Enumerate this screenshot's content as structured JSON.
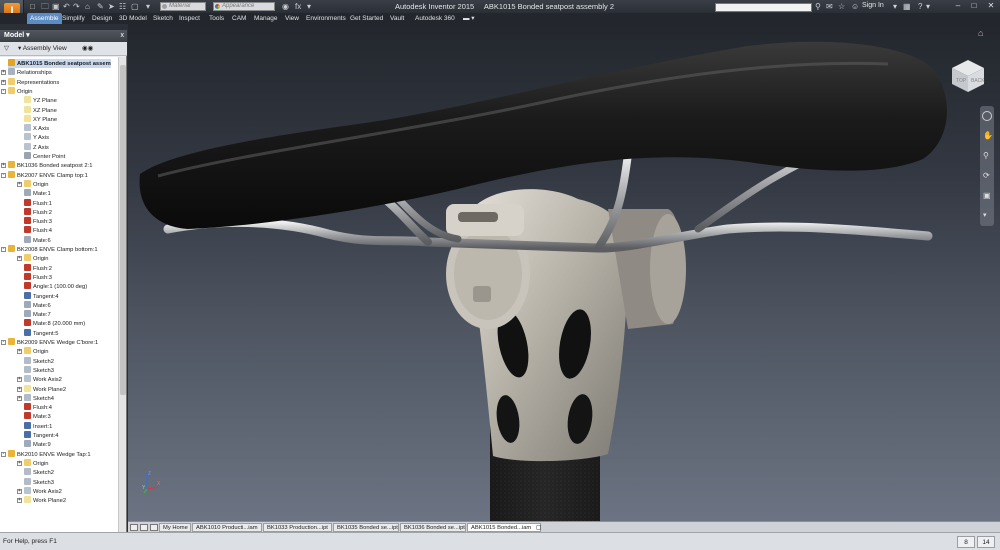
{
  "window": {
    "app_name": "Autodesk Inventor 2015",
    "document_title": "ABK1015 Bonded seatpost assembly 2"
  },
  "quick_access": {
    "material_placeholder": "Material",
    "appearance_placeholder": "Appearance"
  },
  "signin_label": "Sign In",
  "ribbon_tabs": [
    "Assemble",
    "Simplify",
    "Design",
    "3D Model",
    "Sketch",
    "Inspect",
    "Tools",
    "CAM",
    "Manage",
    "View",
    "Environments",
    "Get Started",
    "Vault",
    "Autodesk 360"
  ],
  "browser": {
    "title": "Model",
    "view_selector": "Assembly View",
    "close_label": "x"
  },
  "tree": [
    {
      "label": "ABK1015 Bonded seatpost assem",
      "level": 0,
      "icon": "assembly-icon",
      "exp": "",
      "root": true
    },
    {
      "label": "Relationships",
      "level": 0,
      "icon": "relationships-icon",
      "exp": "+"
    },
    {
      "label": "Representations",
      "level": 0,
      "icon": "folder-icon",
      "exp": "+"
    },
    {
      "label": "Origin",
      "level": 0,
      "icon": "folder-icon",
      "exp": "-"
    },
    {
      "label": "YZ Plane",
      "level": 1,
      "icon": "plane-icon"
    },
    {
      "label": "XZ Plane",
      "level": 1,
      "icon": "plane-icon"
    },
    {
      "label": "XY Plane",
      "level": 1,
      "icon": "plane-icon"
    },
    {
      "label": "X Axis",
      "level": 1,
      "icon": "axis-icon"
    },
    {
      "label": "Y Axis",
      "level": 1,
      "icon": "axis-icon"
    },
    {
      "label": "Z Axis",
      "level": 1,
      "icon": "axis-icon"
    },
    {
      "label": "Center Point",
      "level": 1,
      "icon": "point-icon"
    },
    {
      "label": "BK1036 Bonded seatpost 2:1",
      "level": 0,
      "icon": "part-icon",
      "exp": "+"
    },
    {
      "label": "BK2007 ENVE Clamp top:1",
      "level": 0,
      "icon": "part-icon",
      "exp": "-"
    },
    {
      "label": "Origin",
      "level": 1,
      "icon": "folder-icon",
      "exp": "+"
    },
    {
      "label": "Mate:1",
      "level": 1,
      "icon": "mate-icon"
    },
    {
      "label": "Flush:1",
      "level": 1,
      "icon": "flush-icon"
    },
    {
      "label": "Flush:2",
      "level": 1,
      "icon": "flush-icon"
    },
    {
      "label": "Flush:3",
      "level": 1,
      "icon": "flush-icon"
    },
    {
      "label": "Flush:4",
      "level": 1,
      "icon": "flush-icon"
    },
    {
      "label": "Mate:6",
      "level": 1,
      "icon": "mate-icon"
    },
    {
      "label": "BK2008 ENVE Clamp bottom:1",
      "level": 0,
      "icon": "part-icon",
      "exp": "-"
    },
    {
      "label": "Origin",
      "level": 1,
      "icon": "folder-icon",
      "exp": "+"
    },
    {
      "label": "Flush:2",
      "level": 1,
      "icon": "flush-icon"
    },
    {
      "label": "Flush:3",
      "level": 1,
      "icon": "flush-icon"
    },
    {
      "label": "Angle:1 (100.00 deg)",
      "level": 1,
      "icon": "angle-icon"
    },
    {
      "label": "Tangent:4",
      "level": 1,
      "icon": "tangent-icon"
    },
    {
      "label": "Mate:6",
      "level": 1,
      "icon": "mate-icon"
    },
    {
      "label": "Mate:7",
      "level": 1,
      "icon": "mate-icon"
    },
    {
      "label": "Mate:8 (20.000 mm)",
      "level": 1,
      "icon": "flush-icon"
    },
    {
      "label": "Tangent:5",
      "level": 1,
      "icon": "tangent-icon"
    },
    {
      "label": "BK2009 ENVE Wedge C'bore:1",
      "level": 0,
      "icon": "part-icon",
      "exp": "-"
    },
    {
      "label": "Origin",
      "level": 1,
      "icon": "folder-icon",
      "exp": "+"
    },
    {
      "label": "Sketch2",
      "level": 1,
      "icon": "sketch-icon"
    },
    {
      "label": "Sketch3",
      "level": 1,
      "icon": "sketch-icon"
    },
    {
      "label": "Work Axis2",
      "level": 1,
      "icon": "axis-icon",
      "exp": "+"
    },
    {
      "label": "Work Plane2",
      "level": 1,
      "icon": "plane-icon",
      "exp": "+"
    },
    {
      "label": "Sketch4",
      "level": 1,
      "icon": "sketch-icon",
      "exp": "+"
    },
    {
      "label": "Flush:4",
      "level": 1,
      "icon": "flush-icon"
    },
    {
      "label": "Mate:3",
      "level": 1,
      "icon": "flush-icon"
    },
    {
      "label": "Insert:1",
      "level": 1,
      "icon": "insert-icon"
    },
    {
      "label": "Tangent:4",
      "level": 1,
      "icon": "tangent-icon"
    },
    {
      "label": "Mate:9",
      "level": 1,
      "icon": "mate-icon"
    },
    {
      "label": "BK2010 ENVE Wedge Tap:1",
      "level": 0,
      "icon": "part-icon",
      "exp": "-"
    },
    {
      "label": "Origin",
      "level": 1,
      "icon": "folder-icon",
      "exp": "+"
    },
    {
      "label": "Sketch2",
      "level": 1,
      "icon": "sketch-icon"
    },
    {
      "label": "Sketch3",
      "level": 1,
      "icon": "sketch-icon"
    },
    {
      "label": "Work Axis2",
      "level": 1,
      "icon": "axis-icon",
      "exp": "+"
    },
    {
      "label": "Work Plane2",
      "level": 1,
      "icon": "plane-icon",
      "exp": "+"
    }
  ],
  "viewcube": {
    "top_label": "TOP",
    "back_label": "BACK"
  },
  "triad": {
    "x_label": "X",
    "y_label": "Y",
    "z_label": "Z"
  },
  "doc_tabs": [
    {
      "label": "My Home",
      "active": false
    },
    {
      "label": "ABK1010 Producti...iam",
      "active": false
    },
    {
      "label": "BK1033 Production...ipt",
      "active": false
    },
    {
      "label": "BK1035 Bonded se...ipt",
      "active": false
    },
    {
      "label": "BK1036 Bonded se...ipt",
      "active": false
    },
    {
      "label": "ABK1015 Bonded...iam",
      "active": true
    }
  ],
  "status": {
    "message": "For Help, press F1",
    "count_a": "8",
    "count_b": "14"
  },
  "colors": {
    "accent": "#5b8cc4",
    "orange": "#e07b1f",
    "viewport_top": "#23272d",
    "viewport_bottom": "#6c7483"
  }
}
